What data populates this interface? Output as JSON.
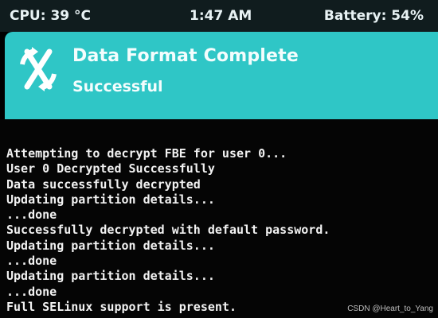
{
  "status_bar": {
    "cpu": "CPU: 39 °C",
    "time": "1:47 AM",
    "battery": "Battery: 54%"
  },
  "header": {
    "title": "Data Format Complete",
    "subtitle": "Successful",
    "logo_icon": "twrp-logo-icon"
  },
  "console": {
    "lines": [
      "Attempting to decrypt FBE for user 0...",
      "User 0 Decrypted Successfully",
      "Data successfully decrypted",
      "Updating partition details...",
      "...done",
      "Successfully decrypted with default password.",
      "Updating partition details...",
      "...done",
      "Updating partition details...",
      "...done",
      "Full SELinux support is present."
    ]
  },
  "watermark": "CSDN @Heart_to_Yang",
  "colors": {
    "header_bg": "#2fc6c6",
    "status_bg": "#101c1e",
    "console_bg": "#050505",
    "text": "#f2f2f2"
  }
}
